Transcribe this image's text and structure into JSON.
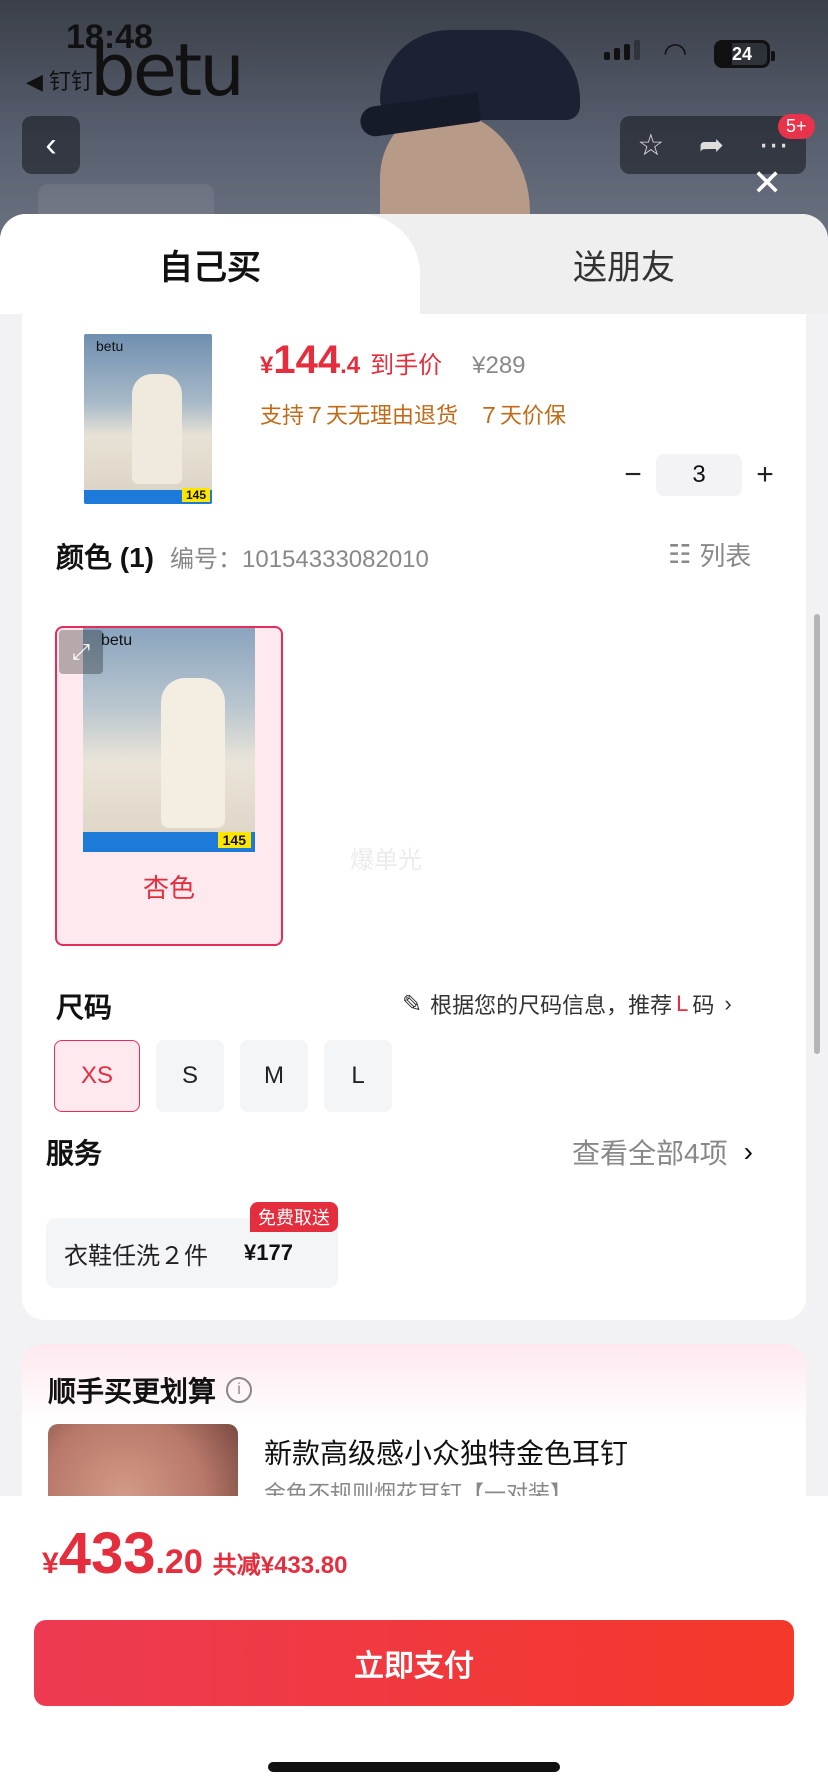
{
  "status_bar": {
    "time": "18:48",
    "back_app": "◀ 钉钉",
    "battery": "24"
  },
  "background": {
    "brand_logo": "betu",
    "notification_badge": "5+"
  },
  "tabs": {
    "self_buy": "自己买",
    "gift": "送朋友"
  },
  "product": {
    "currency": "¥",
    "price_int": "144",
    "price_dec": ".4",
    "price_tag": "到手价",
    "original_price": "¥289",
    "guarantees": [
      "支持７天无理由退货",
      "７天价保"
    ],
    "quantity": "3",
    "thumb_logo": "betu",
    "thumb_price": "145"
  },
  "color": {
    "title": "颜色 (1)",
    "code": "编号：10154333082010",
    "list_label": "列表",
    "option_label": "杏色",
    "watermark": "爆单光"
  },
  "size": {
    "title": "尺码",
    "hint_prefix": "根据您的尺码信息，推荐",
    "hint_size": "L",
    "hint_suffix": "码",
    "options": [
      "XS",
      "S",
      "M",
      "L"
    ],
    "selected": "XS"
  },
  "service": {
    "title": "服务",
    "more": "查看全部4项",
    "item_name": "衣鞋任洗２件",
    "item_price": "¥177",
    "badge": "免费取送"
  },
  "upsell": {
    "title": "顺手买更划算",
    "product_name": "新款高级感小众独特金色耳钉",
    "product_sub": "金色不规则烟花耳钉【一对装】"
  },
  "footer": {
    "currency": "¥",
    "total_int": "433",
    "total_dec": ".20",
    "saving": "共减¥433.80",
    "pay_label": "立即支付"
  },
  "colors": {
    "accent": "#e42d3d",
    "guarantee": "#c26a18",
    "pay_start": "#ed3a52",
    "pay_end": "#f4382a"
  }
}
